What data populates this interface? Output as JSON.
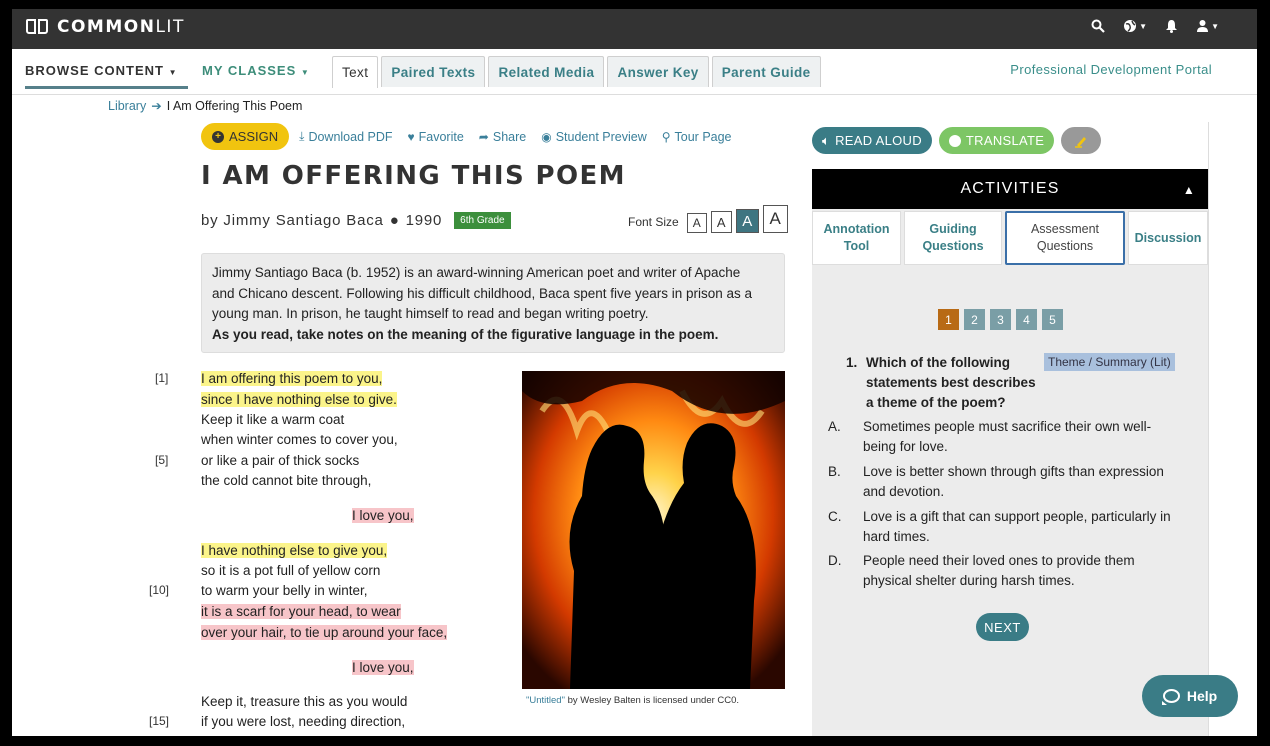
{
  "topbar": {
    "logo_bold": "COMMON",
    "logo_light": "LIT",
    "icons": [
      "search-icon",
      "globe-icon",
      "bell-icon",
      "user-icon"
    ]
  },
  "nav": {
    "browse": "BROWSE CONTENT",
    "classes": "MY CLASSES",
    "tabs": [
      "Text",
      "Paired Texts",
      "Related Media",
      "Answer Key",
      "Parent Guide"
    ],
    "active_tab": "Text",
    "portal": "Professional Development Portal"
  },
  "breadcrumb": {
    "root": "Library",
    "current": "I Am Offering This Poem"
  },
  "actions": {
    "assign": "ASSIGN",
    "download": "Download PDF",
    "favorite": "Favorite",
    "share": "Share",
    "preview": "Student Preview",
    "tour": "Tour Page"
  },
  "text": {
    "title": "I AM OFFERING THIS POEM",
    "author": "by Jimmy Santiago Baca",
    "year": "1990",
    "grade": "6th Grade",
    "font_size_label": "Font Size",
    "font_buttons": [
      "A",
      "A",
      "A",
      "A"
    ],
    "intro_line1": "Jimmy Santiago Baca (b. 1952) is an award-winning American poet and writer of Apache",
    "intro_line2": "and Chicano descent. Following his difficult childhood, Baca spent five years in prison as a",
    "intro_line3": "young man. In prison, he taught himself to read and began writing poetry.",
    "intro_instruction": "As you read, take notes on the meaning of the figurative language in the poem."
  },
  "poem": {
    "line_numbers": [
      "[1]",
      "[5]",
      "[10]",
      "[15]"
    ],
    "lines": [
      "I am offering this poem to you,",
      "since I have nothing else to give.",
      "Keep it like a warm coat",
      "when winter comes to cover you,",
      "or like a pair of thick socks",
      "the cold cannot bite through,",
      "I love you,",
      "I have nothing else to give you,",
      "so it is a pot full of yellow corn",
      "to warm your belly in winter,",
      "it is a scarf for your head, to wear",
      "over your hair, to tie up around your face,",
      "I love you,",
      "Keep it, treasure this as you would",
      "if you were lost, needing direction,"
    ]
  },
  "image": {
    "caption_link": "\"Untitled\"",
    "caption_rest": " by Wesley Balten is licensed under CC0."
  },
  "panel": {
    "read_aloud": "READ ALOUD",
    "translate": "TRANSLATE",
    "header": "ACTIVITIES",
    "tabs": [
      {
        "l1": "Annotation",
        "l2": "Tool"
      },
      {
        "l1": "Guiding",
        "l2": "Questions"
      },
      {
        "l1": "Assessment",
        "l2": "Questions"
      },
      {
        "l1": "Discussion",
        "l2": ""
      }
    ],
    "pages": [
      "1",
      "2",
      "3",
      "4",
      "5"
    ],
    "question_number": "1.",
    "question_text": "Which of the following statements best describes a theme of the poem?",
    "theme_tag": "Theme / Summary (Lit)",
    "choices": [
      {
        "letter": "A.",
        "text": "Sometimes people must sacrifice their own well-being for love."
      },
      {
        "letter": "B.",
        "text": "Love is better shown through gifts than expression and devotion."
      },
      {
        "letter": "C.",
        "text": "Love is a gift that can support people, particularly in hard times."
      },
      {
        "letter": "D.",
        "text": "People need their loved ones to provide them physical shelter during harsh times."
      }
    ],
    "next": "NEXT",
    "help": "Help"
  }
}
